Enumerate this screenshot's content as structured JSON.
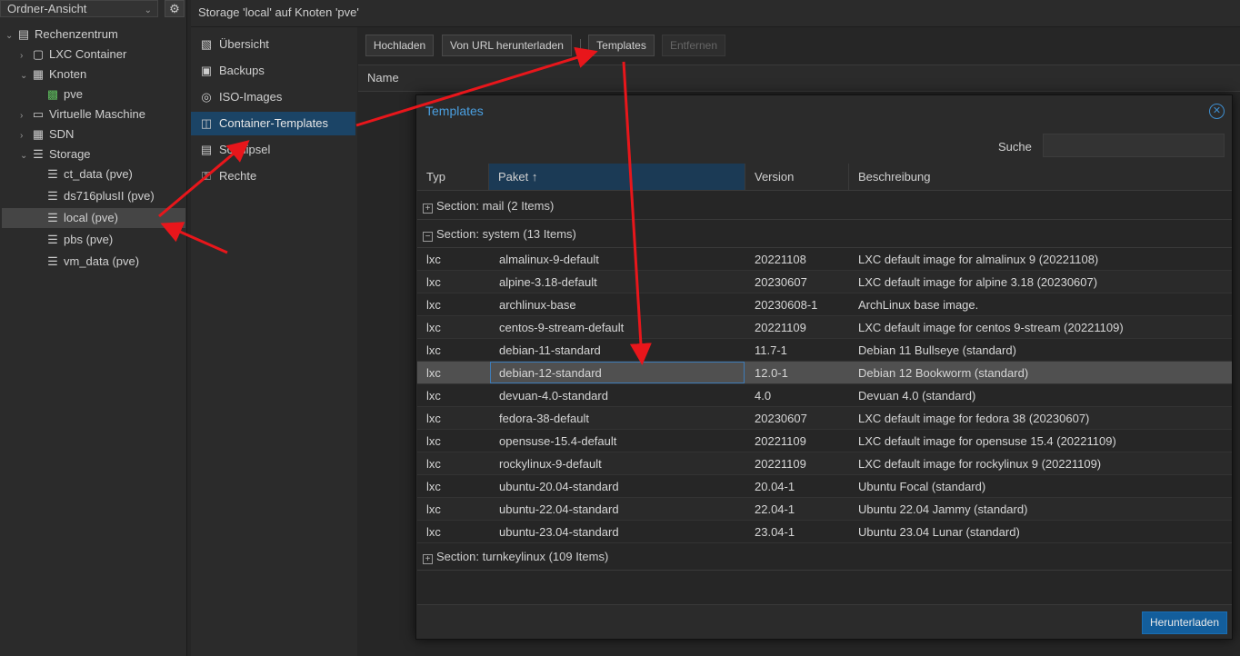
{
  "tree": {
    "view_selector": "Ordner-Ansicht",
    "items": [
      {
        "label": "Rechenzentrum",
        "icon": "datacenter-icon"
      },
      {
        "label": "LXC Container",
        "icon": "container-icon"
      },
      {
        "label": "Knoten",
        "icon": "building-icon"
      },
      {
        "label": "pve",
        "icon": "node-online-icon"
      },
      {
        "label": "Virtuelle Maschine",
        "icon": "monitor-icon"
      },
      {
        "label": "SDN",
        "icon": "grid-icon"
      },
      {
        "label": "Storage",
        "icon": "database-icon"
      },
      {
        "label": "ct_data (pve)",
        "icon": "storage-icon"
      },
      {
        "label": "ds716plusII (pve)",
        "icon": "storage-icon"
      },
      {
        "label": "local (pve)",
        "icon": "storage-icon"
      },
      {
        "label": "pbs (pve)",
        "icon": "storage-icon"
      },
      {
        "label": "vm_data (pve)",
        "icon": "storage-icon"
      }
    ]
  },
  "header": {
    "title": "Storage 'local' auf Knoten 'pve'"
  },
  "nav": {
    "items": [
      {
        "label": "Übersicht",
        "icon": "book-icon"
      },
      {
        "label": "Backups",
        "icon": "floppy-icon"
      },
      {
        "label": "ISO-Images",
        "icon": "disc-icon"
      },
      {
        "label": "Container-Templates",
        "icon": "template-icon"
      },
      {
        "label": "Schnipsel",
        "icon": "snippet-icon"
      },
      {
        "label": "Rechte",
        "icon": "unlock-icon"
      }
    ]
  },
  "toolbar": {
    "upload": "Hochladen",
    "download_url": "Von URL herunterladen",
    "templates": "Templates",
    "remove": "Entfernen"
  },
  "list_header": {
    "name": "Name"
  },
  "modal": {
    "title": "Templates",
    "search_label": "Suche",
    "search_value": "",
    "columns": {
      "typ": "Typ",
      "paket": "Paket",
      "version": "Version",
      "beschreibung": "Beschreibung"
    },
    "sort_indicator": "↑",
    "groups": {
      "mail": "Section: mail (2 Items)",
      "system": "Section: system (13 Items)",
      "turnkey": "Section: turnkeylinux (109 Items)"
    },
    "rows": [
      {
        "typ": "lxc",
        "paket": "almalinux-9-default",
        "version": "20221108",
        "beschreibung": "LXC default image for almalinux 9 (20221108)"
      },
      {
        "typ": "lxc",
        "paket": "alpine-3.18-default",
        "version": "20230607",
        "beschreibung": "LXC default image for alpine 3.18 (20230607)"
      },
      {
        "typ": "lxc",
        "paket": "archlinux-base",
        "version": "20230608-1",
        "beschreibung": "ArchLinux base image."
      },
      {
        "typ": "lxc",
        "paket": "centos-9-stream-default",
        "version": "20221109",
        "beschreibung": "LXC default image for centos 9-stream (20221109)"
      },
      {
        "typ": "lxc",
        "paket": "debian-11-standard",
        "version": "11.7-1",
        "beschreibung": "Debian 11 Bullseye (standard)"
      },
      {
        "typ": "lxc",
        "paket": "debian-12-standard",
        "version": "12.0-1",
        "beschreibung": "Debian 12 Bookworm (standard)"
      },
      {
        "typ": "lxc",
        "paket": "devuan-4.0-standard",
        "version": "4.0",
        "beschreibung": "Devuan 4.0 (standard)"
      },
      {
        "typ": "lxc",
        "paket": "fedora-38-default",
        "version": "20230607",
        "beschreibung": "LXC default image for fedora 38 (20230607)"
      },
      {
        "typ": "lxc",
        "paket": "opensuse-15.4-default",
        "version": "20221109",
        "beschreibung": "LXC default image for opensuse 15.4 (20221109)"
      },
      {
        "typ": "lxc",
        "paket": "rockylinux-9-default",
        "version": "20221109",
        "beschreibung": "LXC default image for rockylinux 9 (20221109)"
      },
      {
        "typ": "lxc",
        "paket": "ubuntu-20.04-standard",
        "version": "20.04-1",
        "beschreibung": "Ubuntu Focal (standard)"
      },
      {
        "typ": "lxc",
        "paket": "ubuntu-22.04-standard",
        "version": "22.04-1",
        "beschreibung": "Ubuntu 22.04 Jammy (standard)"
      },
      {
        "typ": "lxc",
        "paket": "ubuntu-23.04-standard",
        "version": "23.04-1",
        "beschreibung": "Ubuntu 23.04 Lunar (standard)"
      }
    ],
    "download_button": "Herunterladen"
  },
  "colors": {
    "accent": "#135e9c",
    "annotation_arrow": "#e8161b",
    "title_blue": "#4a9fe0"
  }
}
